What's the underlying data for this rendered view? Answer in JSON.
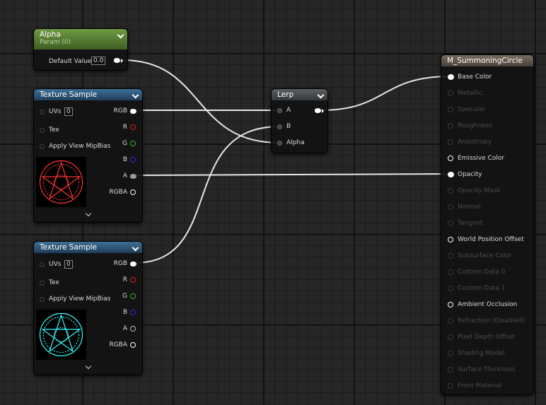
{
  "colors": {
    "param_header": "#5b8537",
    "texture_header": "#2f5a7f",
    "lerp_header": "#4a4e52",
    "result_header": "#6b5e52",
    "wire": "#e6e6e6",
    "pin_r": "#e02020",
    "pin_g": "#20c020",
    "pin_b": "#2030d0",
    "texture1_tint": "#ff3333",
    "texture2_tint": "#33ffff"
  },
  "alpha_node": {
    "title": "Alpha",
    "subtitle": "Param (0)",
    "default_value_label": "Default Value",
    "default_value": "0.0"
  },
  "texture_sample_1": {
    "title": "Texture Sample",
    "uvs_label": "UVs",
    "uvs_value": "0",
    "tex_label": "Tex",
    "mipbias_label": "Apply View MipBias",
    "outputs": [
      "RGB",
      "R",
      "G",
      "B",
      "A",
      "RGBA"
    ],
    "preview_icon": "red-summoning-circle-preview"
  },
  "texture_sample_2": {
    "title": "Texture Sample",
    "uvs_label": "UVs",
    "uvs_value": "0",
    "tex_label": "Tex",
    "mipbias_label": "Apply View MipBias",
    "outputs": [
      "RGB",
      "R",
      "G",
      "B",
      "A",
      "RGBA"
    ],
    "preview_icon": "cyan-summoning-circle-preview"
  },
  "lerp_node": {
    "title": "Lerp",
    "inputs": [
      "A",
      "B",
      "Alpha"
    ]
  },
  "material_node": {
    "title": "M_SummoningCircle",
    "pins": [
      {
        "label": "Base Color",
        "state": "connected"
      },
      {
        "label": "Metallic",
        "state": "disabled"
      },
      {
        "label": "Specular",
        "state": "disabled"
      },
      {
        "label": "Roughness",
        "state": "disabled"
      },
      {
        "label": "Anisotropy",
        "state": "disabled"
      },
      {
        "label": "Emissive Color",
        "state": "enabled"
      },
      {
        "label": "Opacity",
        "state": "connected"
      },
      {
        "label": "Opacity Mask",
        "state": "disabled"
      },
      {
        "label": "Normal",
        "state": "disabled"
      },
      {
        "label": "Tangent",
        "state": "disabled"
      },
      {
        "label": "World Position Offset",
        "state": "enabled"
      },
      {
        "label": "Subsurface Color",
        "state": "disabled"
      },
      {
        "label": "Custom Data 0",
        "state": "disabled"
      },
      {
        "label": "Custom Data 1",
        "state": "disabled"
      },
      {
        "label": "Ambient Occlusion",
        "state": "enabled"
      },
      {
        "label": "Refraction (Disabled)",
        "state": "disabled"
      },
      {
        "label": "Pixel Depth Offset",
        "state": "disabled"
      },
      {
        "label": "Shading Model",
        "state": "disabled"
      },
      {
        "label": "Surface Thickness",
        "state": "disabled"
      },
      {
        "label": "Front Material",
        "state": "disabled"
      }
    ]
  }
}
